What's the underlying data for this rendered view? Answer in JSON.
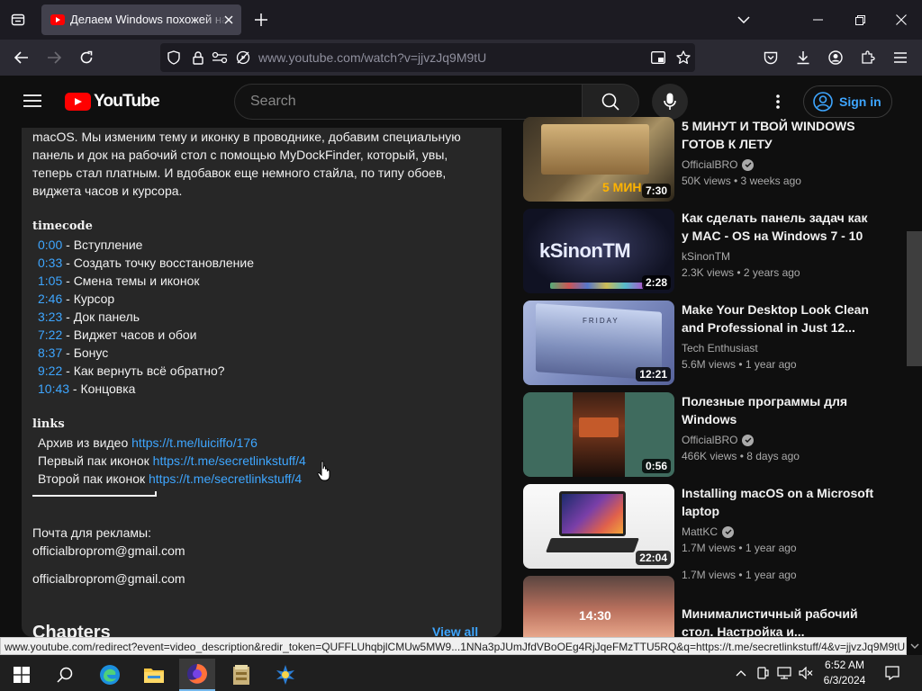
{
  "browser": {
    "tab_title": "Делаем Windows похожей на macOS",
    "url": "www.youtube.com/watch?v=jjvzJq9M9tU"
  },
  "youtube": {
    "logo_text": "YouTube",
    "search_placeholder": "Search",
    "sign_in_label": "Sign in"
  },
  "description": {
    "intro_lines": [
      "macOS. Мы изменим тему и иконку в проводнике, добавим специальную",
      "панель и док на рабочий стол с помощью MyDockFinder, который, увы,",
      "теперь стал платным. И вдобавок еще немного стайла, по типу обоев,",
      "виджета часов и курсора."
    ],
    "timecode_heading": "timecode",
    "timecodes": [
      {
        "time": "0:00",
        "label": " - Вступление"
      },
      {
        "time": "0:33",
        "label": " - Создать точку восстановление"
      },
      {
        "time": "1:05",
        "label": " - Смена темы и иконок"
      },
      {
        "time": "2:46",
        "label": " - Курсор"
      },
      {
        "time": "3:23",
        "label": " - Док панель"
      },
      {
        "time": "7:22",
        "label": " - Виджет часов и обои"
      },
      {
        "time": "8:37",
        "label": " - Бонус"
      },
      {
        "time": "9:22",
        "label": " - Как вернуть всё обратно?"
      },
      {
        "time": "10:43",
        "label": " - Концовка"
      }
    ],
    "links_heading": "links",
    "links": [
      {
        "label": "Архив из видео ",
        "url": "https://t.me/luiciffo/176"
      },
      {
        "label": "Первый пак иконок ",
        "url": "https://t.me/secretlinkstuff/4"
      },
      {
        "label": "Второй пак иконок ",
        "url": "https://t.me/secretlinkstuff/4"
      }
    ],
    "ad_label": "Почта для рекламы:",
    "email_1": "officialbroprom@gmail.com",
    "email_2": "officialbroprom@gmail.com",
    "chapters_label": "Chapters",
    "view_all_label": "View all"
  },
  "recommendations": [
    {
      "title_line1": "5 МИНУТ И ТВОЙ WINDOWS",
      "title_line2": "ГОТОВ К ЛЕТУ",
      "channel": "OfficialBRO",
      "verified": true,
      "meta": "50K views • 3 weeks ago",
      "duration": "7:30",
      "thumb_text": "5 МИН"
    },
    {
      "title_line1": "Как сделать панель задач как",
      "title_line2": "у MAC - OS на Windows 7 - 10",
      "channel": "kSinonTM",
      "verified": false,
      "meta": "2.3K views • 2 years ago",
      "duration": "2:28",
      "thumb_text": "kSinonTM"
    },
    {
      "title_line1": "Make Your Desktop Look Clean",
      "title_line2": "and Professional in Just 12...",
      "channel": "Tech Enthusiast",
      "verified": false,
      "meta": "5.6M views • 1 year ago",
      "duration": "12:21",
      "thumb_text": "FRIDAY"
    },
    {
      "title_line1": "Полезные программы для",
      "title_line2": "Windows",
      "channel": "OfficialBRO",
      "verified": true,
      "meta": "466K views • 8 days ago",
      "duration": "0:56",
      "thumb_text": ""
    },
    {
      "title_line1": "Installing macOS on a Microsoft",
      "title_line2": "laptop",
      "channel": "MattKC",
      "verified": true,
      "meta": "1.7M views • 1 year ago",
      "duration": "22:04",
      "thumb_text": ""
    },
    {
      "title_line1": "Минималистичный рабочий",
      "title_line2": "стол. Настройка и...",
      "channel": "",
      "verified": false,
      "meta": "1.7M views • 1 year ago",
      "duration": "",
      "thumb_text": "14:30"
    }
  ],
  "status_bar": "www.youtube.com/redirect?event=video_description&redir_token=QUFFLUhqbjlCMUw5MW9...1NNa3pJUmJfdVBoOEg4RjJqeFMzTTU5RQ&q=https://t.me/secretlinkstuff/4&v=jjvzJq9M9tU",
  "taskbar": {
    "time": "6:52 AM",
    "date": "6/3/2024"
  }
}
